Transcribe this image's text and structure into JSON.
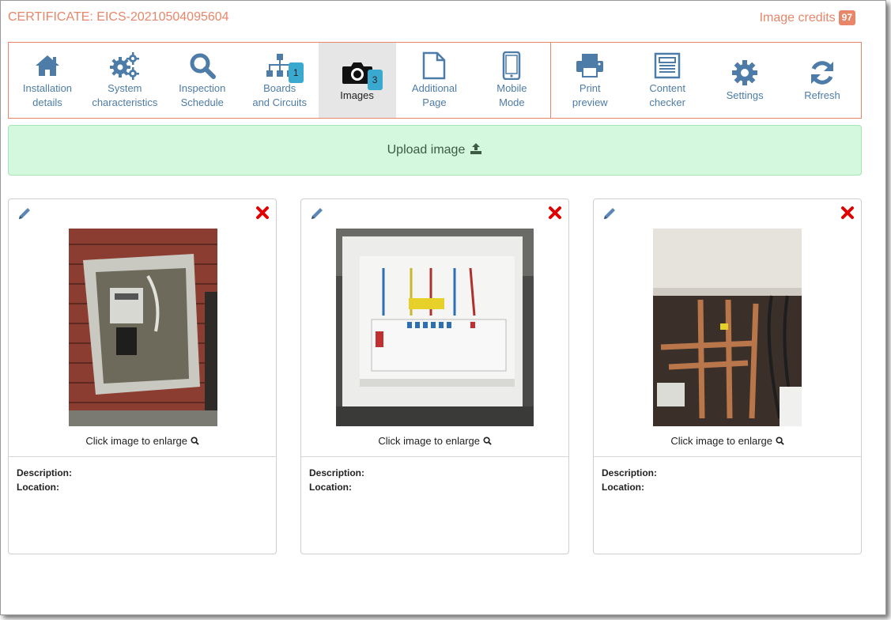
{
  "header": {
    "certificate": "CERTIFICATE: EICS-20210504095604",
    "credits_label": "Image credits",
    "credits_count": "97"
  },
  "toolbar": {
    "items": [
      {
        "label": "Installation\ndetails",
        "icon": "home-icon"
      },
      {
        "label": "System\ncharacteristics",
        "icon": "cogs-icon"
      },
      {
        "label": "Inspection\nSchedule",
        "icon": "search-icon"
      },
      {
        "label": "Boards\nand Circuits",
        "icon": "sitemap-icon",
        "badge": "1"
      },
      {
        "label": "Images",
        "icon": "camera-icon",
        "badge": "3",
        "active": true
      },
      {
        "label": "Additional\nPage",
        "icon": "file-icon"
      },
      {
        "label": "Mobile\nMode",
        "icon": "mobile-icon"
      },
      {
        "label": "Print\npreview",
        "icon": "print-icon"
      },
      {
        "label": "Content\nchecker",
        "icon": "newspaper-icon"
      },
      {
        "label": "Settings",
        "icon": "gear-icon"
      },
      {
        "label": "Refresh",
        "icon": "refresh-icon"
      }
    ]
  },
  "upload": {
    "label": "Upload image",
    "icon": "upload-icon"
  },
  "cards": [
    {
      "enlarge": "Click image to enlarge",
      "description_label": "Description:",
      "location_label": "Location:",
      "photo": "meter-box-photo"
    },
    {
      "enlarge": "Click image to enlarge",
      "description_label": "Description:",
      "location_label": "Location:",
      "photo": "consumer-unit-photo"
    },
    {
      "enlarge": "Click image to enlarge",
      "description_label": "Description:",
      "location_label": "Location:",
      "photo": "pipework-photo"
    }
  ],
  "colors": {
    "accent": "#e8866a",
    "icon_blue": "#4d7ca8",
    "badge": "#3aa9d0",
    "upload_bg": "#d4f8dd",
    "delete_red": "#e00000"
  }
}
